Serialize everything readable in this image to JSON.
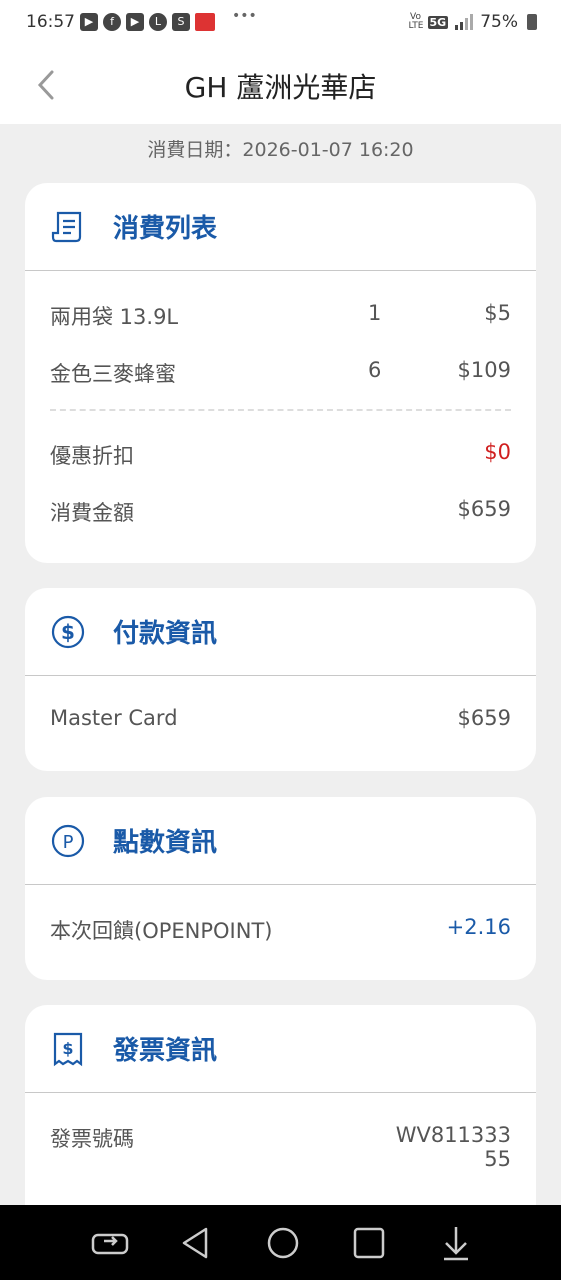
{
  "status_bar": {
    "time": "16:57",
    "network": "5G",
    "volte": "Vo LTE",
    "battery": "75%"
  },
  "header": {
    "title": "GH 蘆洲光華店"
  },
  "date_line": "消費日期：2026-01-07 16:20",
  "purchase_card": {
    "title": "消費列表",
    "items": [
      {
        "name": "兩用袋 13.9L",
        "qty": "1",
        "amount": "$5"
      },
      {
        "name": "金色三麥蜂蜜",
        "qty": "6",
        "amount": "$109"
      }
    ],
    "discount_label": "優惠折扣",
    "discount_value": "$0",
    "total_label": "消費金額",
    "total_value": "$659"
  },
  "payment_card": {
    "title": "付款資訊",
    "method": "Master Card",
    "amount": "$659"
  },
  "points_card": {
    "title": "點數資訊",
    "label": "本次回饋(OPENPOINT)",
    "value": "+2.16"
  },
  "invoice_card": {
    "title": "發票資訊",
    "label": "發票號碼",
    "number_line1": "WV811333",
    "number_line2": "55"
  },
  "colors": {
    "accent": "#1a5aa8",
    "discount": "#d01f1f",
    "background": "#efefef"
  },
  "icons": {
    "back": "chevron-left-icon",
    "list": "receipt-list-icon",
    "payment": "dollar-circle-icon",
    "points": "p-circle-icon",
    "invoice": "invoice-dollar-icon"
  }
}
